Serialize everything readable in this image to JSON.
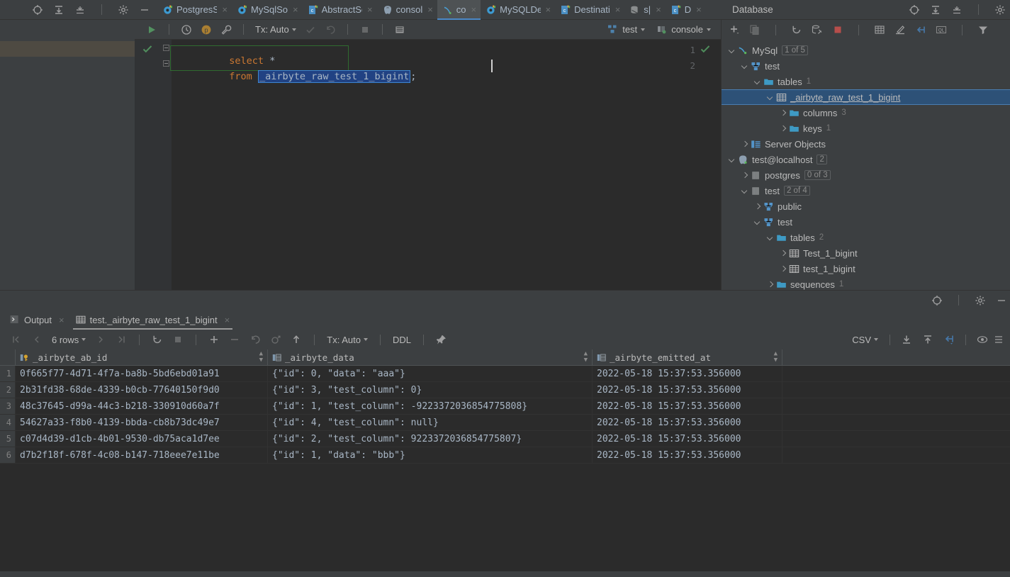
{
  "window": {
    "left_panel_title": "Database"
  },
  "editor_tabs": [
    {
      "label": "PostgresS",
      "icon": "datagrip-console-icon",
      "active": false
    },
    {
      "label": "MySqlSo",
      "icon": "datagrip-console-icon",
      "active": false
    },
    {
      "label": "AbstractSou",
      "icon": "class-file-icon",
      "active": false
    },
    {
      "label": "consol",
      "icon": "postgres-icon",
      "active": false
    },
    {
      "label": "co",
      "icon": "mysql-icon",
      "active": true
    },
    {
      "label": "MySQLDesti",
      "icon": "datagrip-console-icon",
      "active": false
    },
    {
      "label": "Destinati",
      "icon": "class-file-icon",
      "active": false
    },
    {
      "label": "s|",
      "icon": "sql-file-icon",
      "active": false
    },
    {
      "label": "D",
      "icon": "class-file-icon",
      "active": false
    }
  ],
  "editor_toolbar": {
    "run_label": "run-query",
    "tx_label": "Tx: Auto",
    "schema_chip": "test",
    "session_chip": "console"
  },
  "sql": {
    "lines": [
      {
        "num": "1",
        "kw": "select",
        "rest": " *",
        "selected": ""
      },
      {
        "num": "2",
        "kw": "from",
        "rest": " ",
        "selected": "_airbyte_raw_test_1_bigint",
        "tail": ";"
      }
    ]
  },
  "db_tree": [
    {
      "depth": 0,
      "arrow": "down",
      "icon": "mysql-icon",
      "label": "MySql",
      "badge": "1 of 5",
      "badge_box": true,
      "selected": false
    },
    {
      "depth": 1,
      "arrow": "down",
      "icon": "schema-icon",
      "label": "test",
      "badge": "",
      "badge_box": false,
      "selected": false
    },
    {
      "depth": 2,
      "arrow": "down",
      "icon": "folder-icon",
      "label": "tables",
      "badge": "1",
      "badge_box": false,
      "selected": false
    },
    {
      "depth": 3,
      "arrow": "down",
      "icon": "table-icon",
      "label": "_airbyte_raw_test_1_bigint",
      "badge": "",
      "badge_box": false,
      "selected": true
    },
    {
      "depth": 4,
      "arrow": "right",
      "icon": "folder-icon",
      "label": "columns",
      "badge": "3",
      "badge_box": false,
      "selected": false
    },
    {
      "depth": 4,
      "arrow": "right",
      "icon": "folder-icon",
      "label": "keys",
      "badge": "1",
      "badge_box": false,
      "selected": false
    },
    {
      "depth": 1,
      "arrow": "right",
      "icon": "server-objects-icon",
      "label": "Server Objects",
      "badge": "",
      "badge_box": false,
      "selected": false
    },
    {
      "depth": 0,
      "arrow": "down",
      "icon": "postgres-icon",
      "label": "test@localhost",
      "badge": "2",
      "badge_box": true,
      "selected": false
    },
    {
      "depth": 1,
      "arrow": "right",
      "icon": "database-icon",
      "label": "postgres",
      "badge": "0 of 3",
      "badge_box": true,
      "selected": false
    },
    {
      "depth": 1,
      "arrow": "down",
      "icon": "database-icon",
      "label": "test",
      "badge": "2 of 4",
      "badge_box": true,
      "selected": false
    },
    {
      "depth": 2,
      "arrow": "right",
      "icon": "schema-icon",
      "label": "public",
      "badge": "",
      "badge_box": false,
      "selected": false
    },
    {
      "depth": 2,
      "arrow": "down",
      "icon": "schema-icon",
      "label": "test",
      "badge": "",
      "badge_box": false,
      "selected": false
    },
    {
      "depth": 3,
      "arrow": "down",
      "icon": "folder-icon",
      "label": "tables",
      "badge": "2",
      "badge_box": false,
      "selected": false
    },
    {
      "depth": 4,
      "arrow": "right",
      "icon": "table-icon",
      "label": "Test_1_bigint",
      "badge": "",
      "badge_box": false,
      "selected": false
    },
    {
      "depth": 4,
      "arrow": "right",
      "icon": "table-icon",
      "label": "test_1_bigint",
      "badge": "",
      "badge_box": false,
      "selected": false
    },
    {
      "depth": 3,
      "arrow": "right",
      "icon": "folder-icon",
      "label": "sequences",
      "badge": "1",
      "badge_box": false,
      "selected": false
    }
  ],
  "result_tabs": [
    {
      "label": "Output",
      "icon": "console-output-icon",
      "active": false
    },
    {
      "label": "test._airbyte_raw_test_1_bigint",
      "icon": "table-icon",
      "active": true
    }
  ],
  "grid_toolbar": {
    "rows_label": "6 rows",
    "tx_label": "Tx: Auto",
    "ddl_label": "DDL",
    "format_label": "CSV"
  },
  "grid": {
    "columns": [
      {
        "name": "_airbyte_ab_id",
        "icon": "primary-key-column-icon"
      },
      {
        "name": "_airbyte_data",
        "icon": "column-icon"
      },
      {
        "name": "_airbyte_emitted_at",
        "icon": "column-icon"
      }
    ],
    "rows": [
      {
        "n": "1",
        "_airbyte_ab_id": "0f665f77-4d71-4f7a-ba8b-5bd6ebd01a91",
        "_airbyte_data": "{\"id\": 0, \"data\": \"aaa\"}",
        "_airbyte_emitted_at": "2022-05-18 15:37:53.356000"
      },
      {
        "n": "2",
        "_airbyte_ab_id": "2b31fd38-68de-4339-b0cb-77640150f9d0",
        "_airbyte_data": "{\"id\": 3, \"test_column\": 0}",
        "_airbyte_emitted_at": "2022-05-18 15:37:53.356000"
      },
      {
        "n": "3",
        "_airbyte_ab_id": "48c37645-d99a-44c3-b218-330910d60a7f",
        "_airbyte_data": "{\"id\": 1, \"test_column\": -9223372036854775808}",
        "_airbyte_emitted_at": "2022-05-18 15:37:53.356000"
      },
      {
        "n": "4",
        "_airbyte_ab_id": "54627a33-f8b0-4139-bbda-cb8b73dc49e7",
        "_airbyte_data": "{\"id\": 4, \"test_column\": null}",
        "_airbyte_emitted_at": "2022-05-18 15:37:53.356000"
      },
      {
        "n": "5",
        "_airbyte_ab_id": "c07d4d39-d1cb-4b01-9530-db75aca1d7ee",
        "_airbyte_data": "{\"id\": 2, \"test_column\": 9223372036854775807}",
        "_airbyte_emitted_at": "2022-05-18 15:37:53.356000"
      },
      {
        "n": "6",
        "_airbyte_ab_id": "d7b2f18f-678f-4c08-b147-718eee7e11be",
        "_airbyte_data": "{\"id\": 1, \"data\": \"bbb\"}",
        "_airbyte_emitted_at": "2022-05-18 15:37:53.356000"
      }
    ]
  },
  "colors": {
    "bg": "#3c3f41",
    "editor_bg": "#2b2b2b",
    "accent_blue": "#4a88c7",
    "selection_blue": "#2d5177",
    "keyword_orange": "#cc7832",
    "text": "#bbbbbb",
    "grid_text": "#a9b7c6"
  }
}
